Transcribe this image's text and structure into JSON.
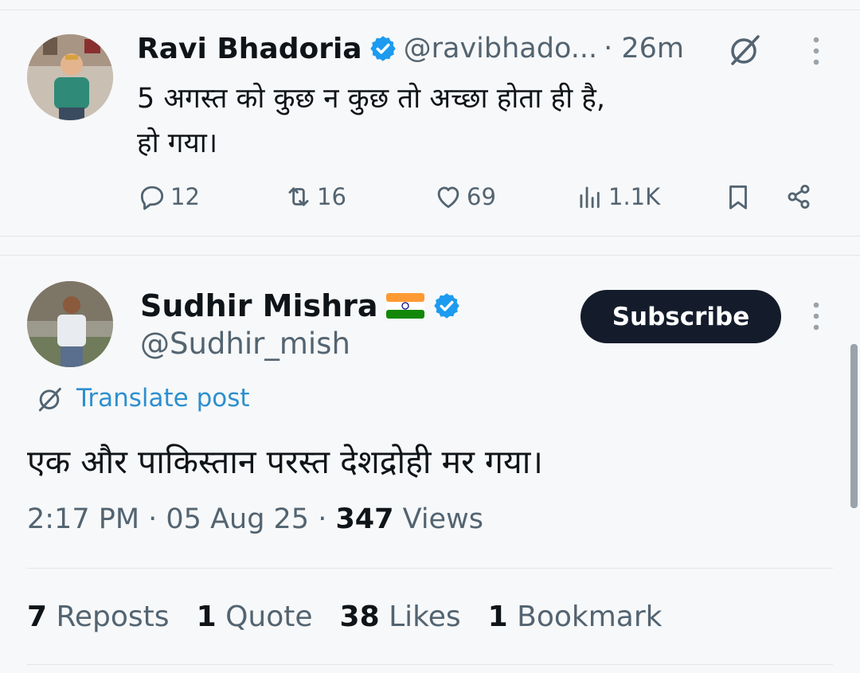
{
  "tweet1": {
    "name": "Ravi Bhadoria",
    "handle": "@ravibhado...",
    "time": "· 26m",
    "text": "5 अगस्त को कुछ न कुछ तो अच्छा होता ही है,\nहो गया।",
    "replies": "12",
    "reposts": "16",
    "likes": "69",
    "views": "1.1K",
    "icons": [
      "verified-icon",
      "grok-icon",
      "more-icon",
      "reply-icon",
      "repost-icon",
      "like-icon",
      "views-icon",
      "bookmark-icon",
      "share-icon"
    ]
  },
  "tweet2": {
    "name": "Sudhir Mishra",
    "handle": "@Sudhir_mish",
    "subscribe_label": "Subscribe",
    "translate_label": "Translate post",
    "text": "एक और पाकिस्तान परस्त देशद्रोही मर गया।",
    "time": "2:17 PM · 05 Aug 25 · ",
    "views_count": "347",
    "views_label": " Views",
    "stats": {
      "reposts_count": "7",
      "reposts_label": " Reposts",
      "quotes_count": "1",
      "quotes_label": " Quote",
      "likes_count": "38",
      "likes_label": " Likes",
      "bookmarks_count": "1",
      "bookmarks_label": " Bookmark"
    },
    "icons": [
      "india-flag-icon",
      "verified-icon",
      "more-icon",
      "translate-icon"
    ]
  },
  "colors": {
    "background": "#f7f8f9",
    "verified": "#1d9bf0",
    "link": "#2d8fcf",
    "subscribe_bg": "#141c2c",
    "muted": "#536471"
  }
}
